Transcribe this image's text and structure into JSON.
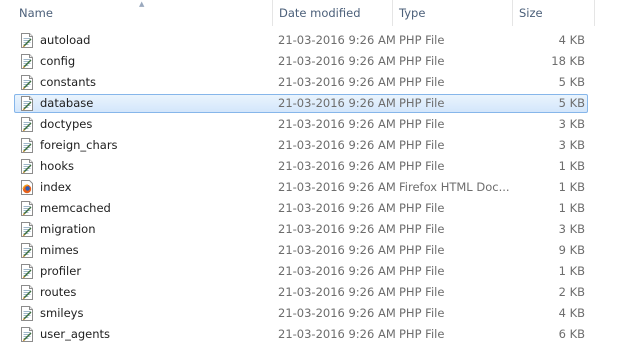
{
  "columns": {
    "name": "Name",
    "date": "Date modified",
    "type": "Type",
    "size": "Size"
  },
  "sort_icon": "sort-up-icon",
  "selected_index": 3,
  "files": [
    {
      "name": "autoload",
      "date": "21-03-2016 9:26 AM",
      "type": "PHP File",
      "size": "4 KB",
      "icon": "php-file-icon"
    },
    {
      "name": "config",
      "date": "21-03-2016 9:26 AM",
      "type": "PHP File",
      "size": "18 KB",
      "icon": "php-file-icon"
    },
    {
      "name": "constants",
      "date": "21-03-2016 9:26 AM",
      "type": "PHP File",
      "size": "5 KB",
      "icon": "php-file-icon"
    },
    {
      "name": "database",
      "date": "21-03-2016 9:26 AM",
      "type": "PHP File",
      "size": "5 KB",
      "icon": "php-file-icon"
    },
    {
      "name": "doctypes",
      "date": "21-03-2016 9:26 AM",
      "type": "PHP File",
      "size": "3 KB",
      "icon": "php-file-icon"
    },
    {
      "name": "foreign_chars",
      "date": "21-03-2016 9:26 AM",
      "type": "PHP File",
      "size": "3 KB",
      "icon": "php-file-icon"
    },
    {
      "name": "hooks",
      "date": "21-03-2016 9:26 AM",
      "type": "PHP File",
      "size": "1 KB",
      "icon": "php-file-icon"
    },
    {
      "name": "index",
      "date": "21-03-2016 9:26 AM",
      "type": "Firefox HTML Doc...",
      "size": "1 KB",
      "icon": "firefox-html-icon"
    },
    {
      "name": "memcached",
      "date": "21-03-2016 9:26 AM",
      "type": "PHP File",
      "size": "1 KB",
      "icon": "php-file-icon"
    },
    {
      "name": "migration",
      "date": "21-03-2016 9:26 AM",
      "type": "PHP File",
      "size": "3 KB",
      "icon": "php-file-icon"
    },
    {
      "name": "mimes",
      "date": "21-03-2016 9:26 AM",
      "type": "PHP File",
      "size": "9 KB",
      "icon": "php-file-icon"
    },
    {
      "name": "profiler",
      "date": "21-03-2016 9:26 AM",
      "type": "PHP File",
      "size": "1 KB",
      "icon": "php-file-icon"
    },
    {
      "name": "routes",
      "date": "21-03-2016 9:26 AM",
      "type": "PHP File",
      "size": "2 KB",
      "icon": "php-file-icon"
    },
    {
      "name": "smileys",
      "date": "21-03-2016 9:26 AM",
      "type": "PHP File",
      "size": "4 KB",
      "icon": "php-file-icon"
    },
    {
      "name": "user_agents",
      "date": "21-03-2016 9:26 AM",
      "type": "PHP File",
      "size": "6 KB",
      "icon": "php-file-icon"
    }
  ]
}
